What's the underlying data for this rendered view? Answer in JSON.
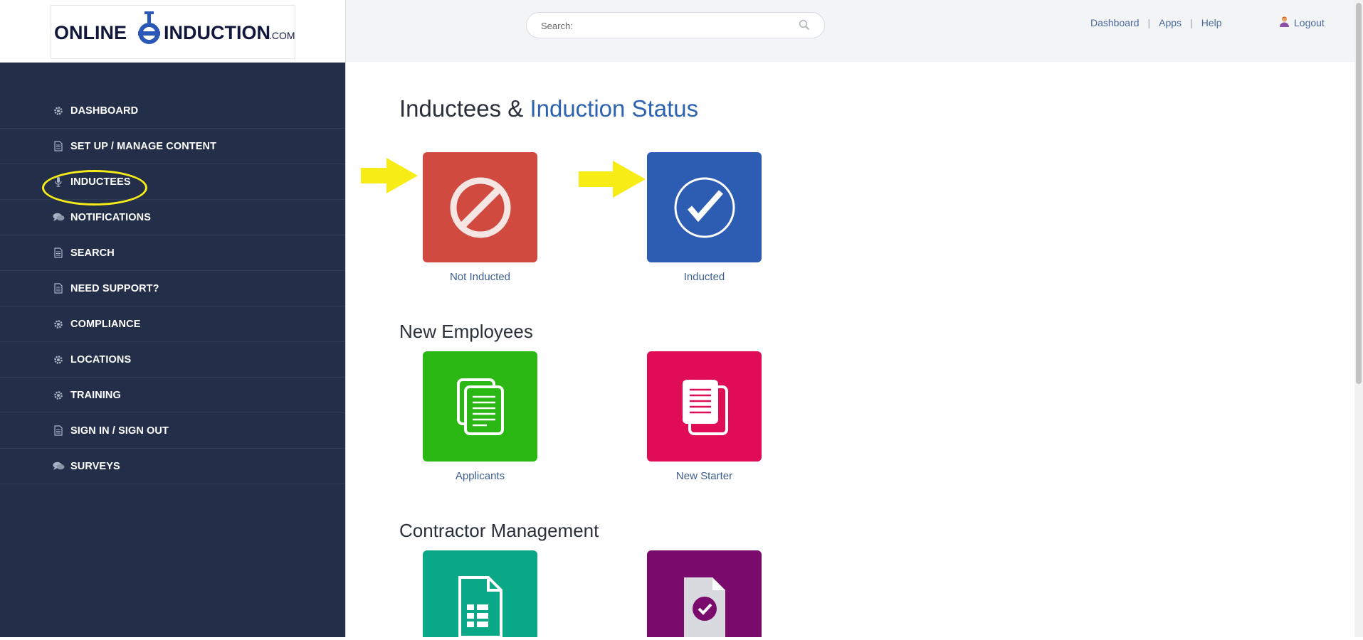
{
  "logo": {
    "text": "ONLINE INDUCTION",
    "suffix": ".COM"
  },
  "sidebar": {
    "items": [
      {
        "label": "DASHBOARD",
        "icon": "gear-icon"
      },
      {
        "label": "SET UP / MANAGE CONTENT",
        "icon": "document-icon"
      },
      {
        "label": "INDUCTEES",
        "icon": "microphone-icon",
        "highlighted": true
      },
      {
        "label": "NOTIFICATIONS",
        "icon": "chat-icon"
      },
      {
        "label": "SEARCH",
        "icon": "document-icon"
      },
      {
        "label": "NEED SUPPORT?",
        "icon": "document-icon"
      },
      {
        "label": "COMPLIANCE",
        "icon": "gear-icon"
      },
      {
        "label": "LOCATIONS",
        "icon": "gear-icon"
      },
      {
        "label": "TRAINING",
        "icon": "gear-icon"
      },
      {
        "label": "SIGN IN / SIGN OUT",
        "icon": "document-icon"
      },
      {
        "label": "SURVEYS",
        "icon": "chat-icon"
      }
    ],
    "highlight_color": "#f7ec16"
  },
  "header": {
    "search_label": "Search:",
    "search_placeholder": "",
    "links": [
      "Dashboard",
      "Apps",
      "Help"
    ],
    "logout": "Logout"
  },
  "main": {
    "section1": {
      "title_prefix": "Inductees &",
      "title_accent": "Induction Status"
    },
    "section2": {
      "title": "New Employees"
    },
    "section3": {
      "title": "Contractor Management"
    },
    "tiles": [
      {
        "label": "Not Inducted",
        "color": "#d04a40",
        "icon": "no-entry-icon"
      },
      {
        "label": "Inducted",
        "color": "#2d5db3",
        "icon": "check-circle-icon"
      },
      {
        "label": "Applicants",
        "color": "#2bb815",
        "icon": "documents-icon"
      },
      {
        "label": "New Starter",
        "color": "#e00d56",
        "icon": "documents-icon"
      },
      {
        "label": "",
        "color": "#0aa886",
        "icon": "spreadsheet-icon"
      },
      {
        "label": "",
        "color": "#7a0a6b",
        "icon": "document-check-icon"
      }
    ],
    "arrow_color": "#f7ec16"
  }
}
